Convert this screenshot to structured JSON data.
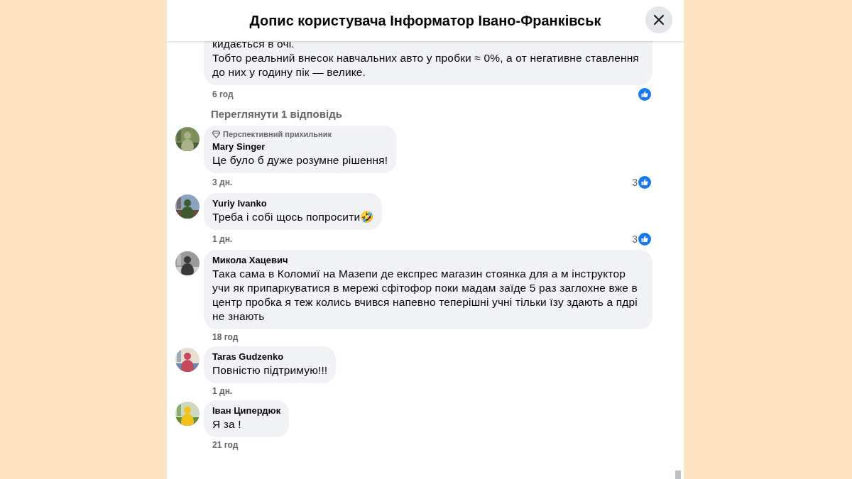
{
  "header": {
    "title": "Допис користувача Інформатор Івано-Франківськ"
  },
  "comments": [
    {
      "text": "кидається в очі.\nТобто реальний внесок навчальних авто у пробки ≈ 0%, а от негативне ставлення до них у годину пік — велике.",
      "time": "6 год",
      "reaction": {
        "kind": "like"
      },
      "replies_link": "Переглянути 1 відповідь",
      "avatar": false
    },
    {
      "badge": "Перспективний прихильник",
      "name": "Mary Singer",
      "text": "Це було б дуже розумне рішення!",
      "time": "3 дн.",
      "reaction": {
        "kind": "like",
        "count": "3"
      },
      "avatar": true
    },
    {
      "name": "Yuriy Ivanko",
      "text": "Треба і собі щось попросити🤣",
      "time": "1 дн.",
      "reaction": {
        "kind": "like",
        "count": "3"
      },
      "avatar": true
    },
    {
      "name": "Микола Хацевич",
      "text": "Така сама в Коломиї на Мазепи де експрес магазин стоянка для а м інструктор учи як припаркуватися в мережі сфітофор поки мадам заїде 5 раз заглохне вже в центр пробка я теж колись вчився напевно теперішні учні тільки їзу здають а пдрі не знають",
      "time": "18 год",
      "avatar": true
    },
    {
      "name": "Taras Gudzenko",
      "text": "Повністю підтримую!!!",
      "time": "1 дн.",
      "avatar": true
    },
    {
      "name": "Іван Ципердюк",
      "text": "Я за !",
      "time": "21 год",
      "avatar": true
    }
  ]
}
